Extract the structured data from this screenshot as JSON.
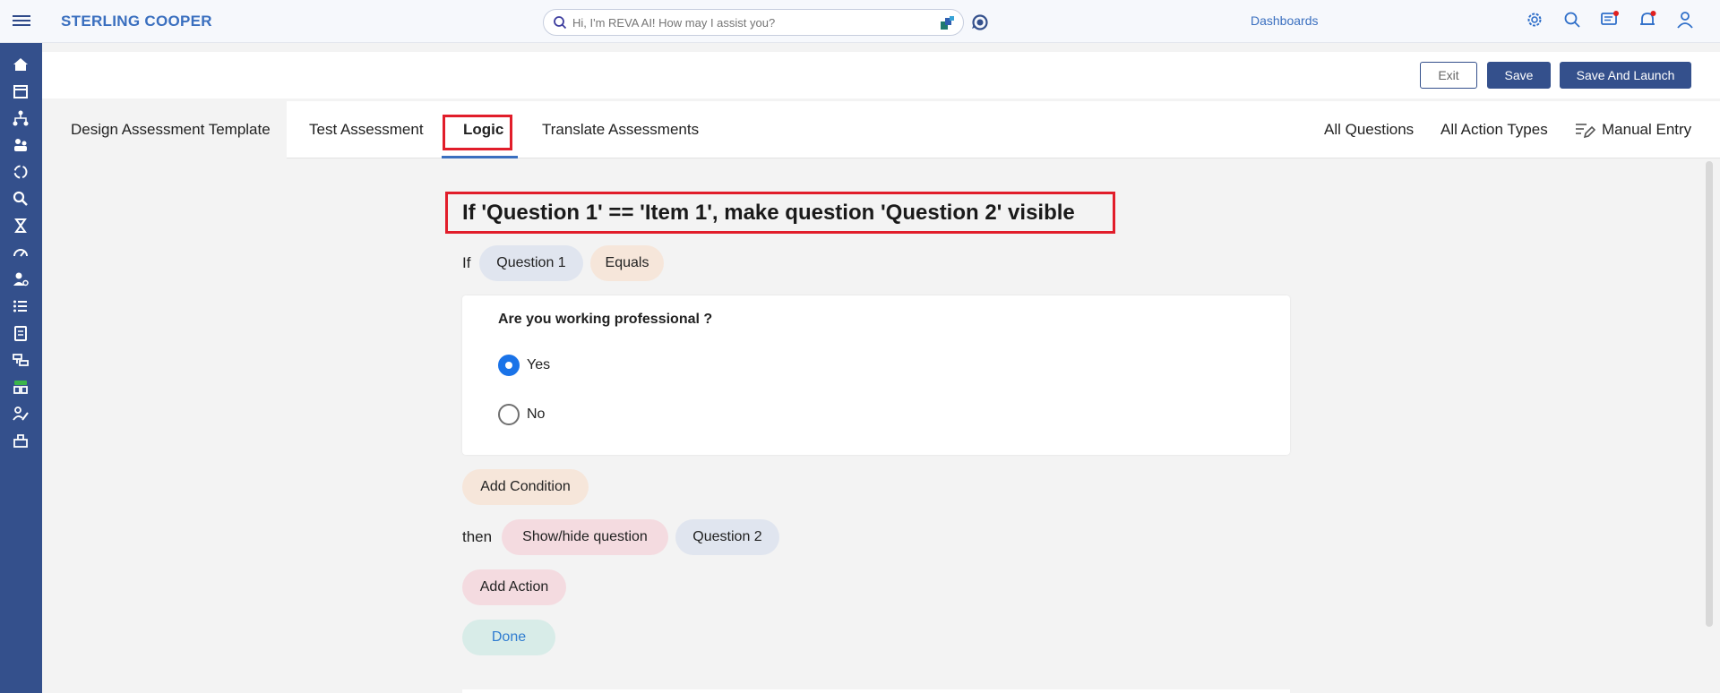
{
  "header": {
    "brand": "STERLING COOPER",
    "search_placeholder": "Hi, I'm REVA AI! How may I assist you?",
    "dashboards": "Dashboards"
  },
  "actions": {
    "exit": "Exit",
    "save": "Save",
    "save_launch": "Save And Launch"
  },
  "tabs": [
    {
      "label": "Design Assessment Template"
    },
    {
      "label": "Test Assessment"
    },
    {
      "label": "Logic",
      "active": true
    },
    {
      "label": "Translate Assessments"
    }
  ],
  "right_tabs": {
    "all_questions": "All Questions",
    "all_action_types": "All Action Types",
    "manual_entry": "Manual Entry"
  },
  "logic": {
    "rule_title": "If 'Question 1' == 'Item 1', make question 'Question 2' visible",
    "if_label": "If",
    "condition_question": "Question 1",
    "condition_operator": "Equals",
    "question": {
      "text": "Are you working professional ?",
      "options": [
        {
          "label": "Yes",
          "selected": true
        },
        {
          "label": "No",
          "selected": false
        }
      ]
    },
    "add_condition": "Add Condition",
    "then_label": "then",
    "action_type": "Show/hide question",
    "action_target": "Question 2",
    "add_action": "Add Action",
    "done": "Done"
  },
  "colors": {
    "sidebar": "#34508c",
    "brand": "#3a6fbf",
    "highlight": "#e11d2a",
    "radio_selected": "#1a73e8"
  }
}
